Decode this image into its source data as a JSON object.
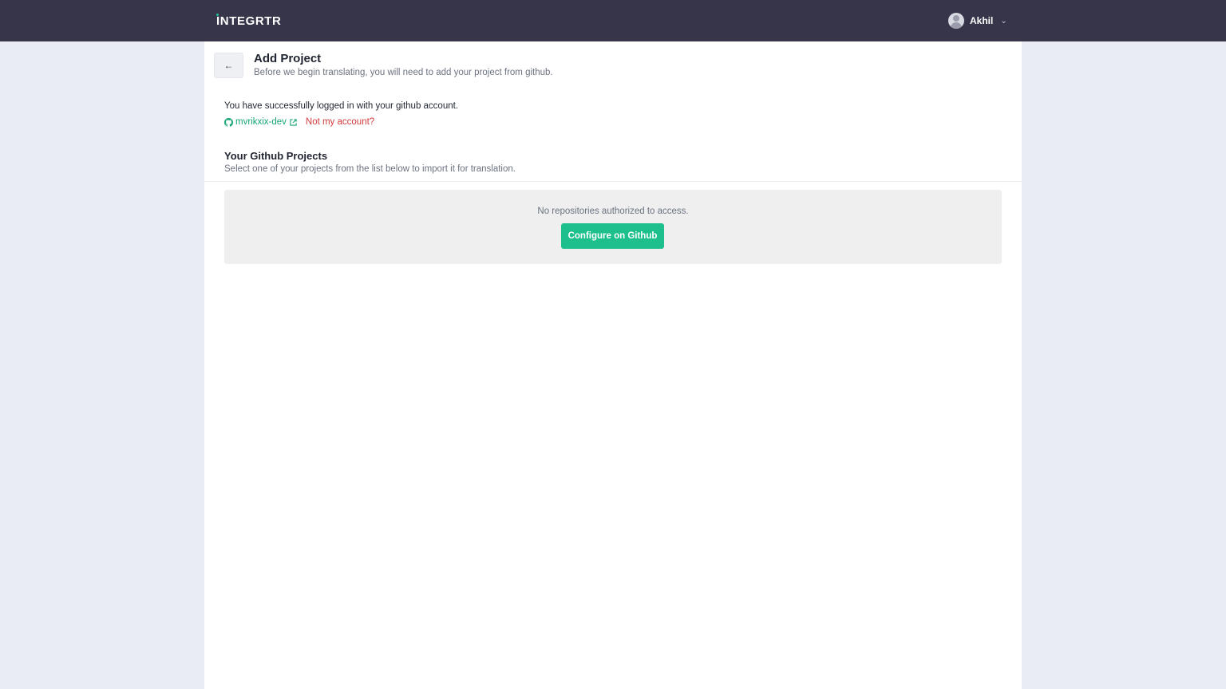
{
  "header": {
    "logo_text": "INTEGRTR",
    "user_name": "Akhil",
    "user_menu_icon": "chevron-down-icon",
    "colors": {
      "bar": "#363549",
      "accent": "#1cc08f"
    }
  },
  "page": {
    "back_icon": "arrow-left-icon",
    "back_glyph": "←",
    "title": "Add Project",
    "subtitle": "Before we begin translating, you will need to add your project from github."
  },
  "account": {
    "success_message": "You have successfully logged in with your github account.",
    "username": "mvrikxix-dev",
    "github_icon": "github-icon",
    "external_icon": "external-link-icon",
    "not_my_account": "Not my account?"
  },
  "projects": {
    "title": "Your Github Projects",
    "subtitle": "Select one of your projects from the list below to import it for translation.",
    "empty_message": "No repositories authorized to access.",
    "configure_button": "Configure on Github",
    "colors": {
      "button": "#1dbf8c",
      "link": "#17a578",
      "danger": "#d23b3b"
    }
  }
}
